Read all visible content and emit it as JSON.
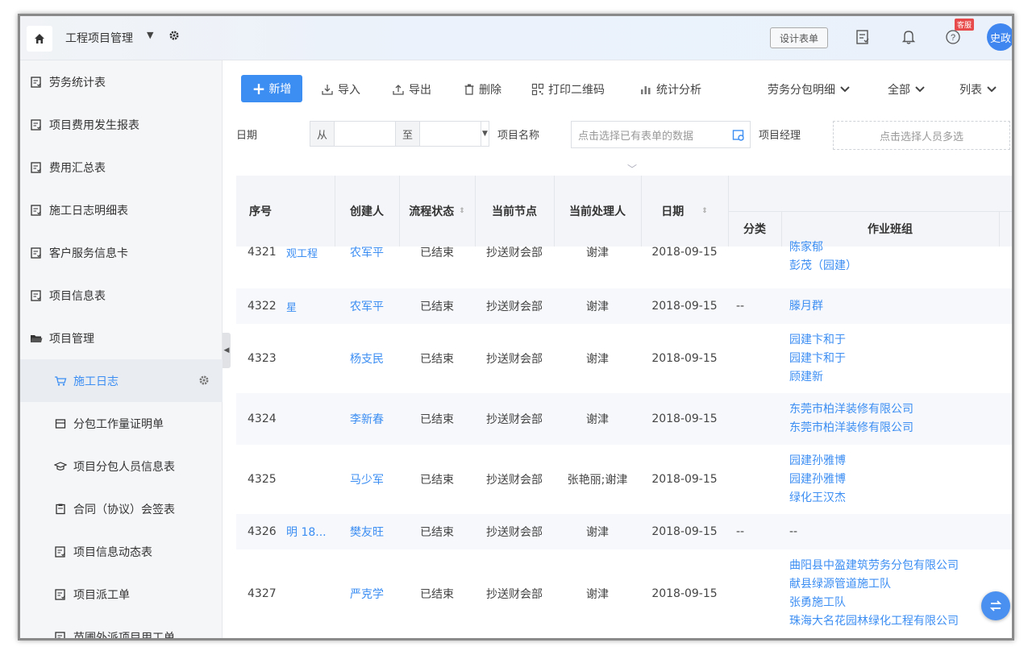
{
  "header": {
    "app_title": "工程项目管理",
    "design_form_label": "设计表单",
    "badge_label": "客服",
    "user_name": "史政"
  },
  "sidebar": {
    "items": [
      {
        "label": "劳务统计表"
      },
      {
        "label": "项目费用发生报表"
      },
      {
        "label": "费用汇总表"
      },
      {
        "label": "施工日志明细表"
      },
      {
        "label": "客户服务信息卡"
      },
      {
        "label": "项目信息表"
      },
      {
        "label": "项目管理"
      },
      {
        "label": "施工日志"
      },
      {
        "label": "分包工作量证明单"
      },
      {
        "label": "项目分包人员信息表"
      },
      {
        "label": "合同（协议）会签表"
      },
      {
        "label": "项目信息动态表"
      },
      {
        "label": "项目派工单"
      },
      {
        "label": "苗圃外派项目用工单"
      }
    ]
  },
  "toolbar": {
    "add_label": "新增",
    "import_label": "导入",
    "export_label": "导出",
    "delete_label": "删除",
    "print_qr_label": "打印二维码",
    "stats_label": "统计分析",
    "detail_dropdown": "劳务分包明细",
    "scope_dropdown": "全部",
    "view_dropdown": "列表"
  },
  "filters": {
    "date_label": "日期",
    "from_label": "从",
    "to_label": "至",
    "project_name_label": "项目名称",
    "project_name_placeholder": "点击选择已有表单的数据",
    "manager_label": "项目经理",
    "manager_placeholder": "点击选择人员多选"
  },
  "table": {
    "headers": {
      "seq": "序号",
      "creator": "创建人",
      "status": "流程状态",
      "node": "当前节点",
      "handler": "当前处理人",
      "date": "日期",
      "category": "分类",
      "team": "作业班组"
    },
    "rows": [
      {
        "seq": "4321",
        "project": "观工程",
        "creator": "农军平",
        "status": "已结束",
        "node": "抄送财会部",
        "handler": "谢津",
        "date": "2018-09-15",
        "category": "",
        "teams": [
          "陈家郁",
          "彭茂（园建）"
        ]
      },
      {
        "seq": "4322",
        "project": "星",
        "creator": "农军平",
        "status": "已结束",
        "node": "抄送财会部",
        "handler": "谢津",
        "date": "2018-09-15",
        "category": "--",
        "teams": [
          "滕月群"
        ]
      },
      {
        "seq": "4323",
        "project": "",
        "creator": "杨支民",
        "status": "已结束",
        "node": "抄送财会部",
        "handler": "谢津",
        "date": "2018-09-15",
        "category": "",
        "teams": [
          "园建卞和于",
          "园建卞和于",
          "顾建新"
        ]
      },
      {
        "seq": "4324",
        "project": "",
        "creator": "李新春",
        "status": "已结束",
        "node": "抄送财会部",
        "handler": "谢津",
        "date": "2018-09-15",
        "category": "",
        "teams": [
          "东莞市柏洋装修有限公司",
          "东莞市柏洋装修有限公司"
        ]
      },
      {
        "seq": "4325",
        "project": "",
        "creator": "马少军",
        "status": "已结束",
        "node": "抄送财会部",
        "handler": "张艳丽;谢津",
        "date": "2018-09-15",
        "category": "",
        "teams": [
          "园建孙雅博",
          "园建孙雅博",
          "绿化王汉杰"
        ]
      },
      {
        "seq": "4326",
        "project": "明 18...",
        "creator": "樊友旺",
        "status": "已结束",
        "node": "抄送财会部",
        "handler": "谢津",
        "date": "2018-09-15",
        "category": "--",
        "teams": [
          "--"
        ]
      },
      {
        "seq": "4327",
        "project": "",
        "creator": "严克学",
        "status": "已结束",
        "node": "抄送财会部",
        "handler": "谢津",
        "date": "2018-09-15",
        "category": "",
        "teams": [
          "曲阳县中盈建筑劳务分包有限公司",
          "献县绿源管道施工队",
          "张勇施工队",
          "珠海大名花园林绿化工程有限公司"
        ]
      }
    ]
  }
}
